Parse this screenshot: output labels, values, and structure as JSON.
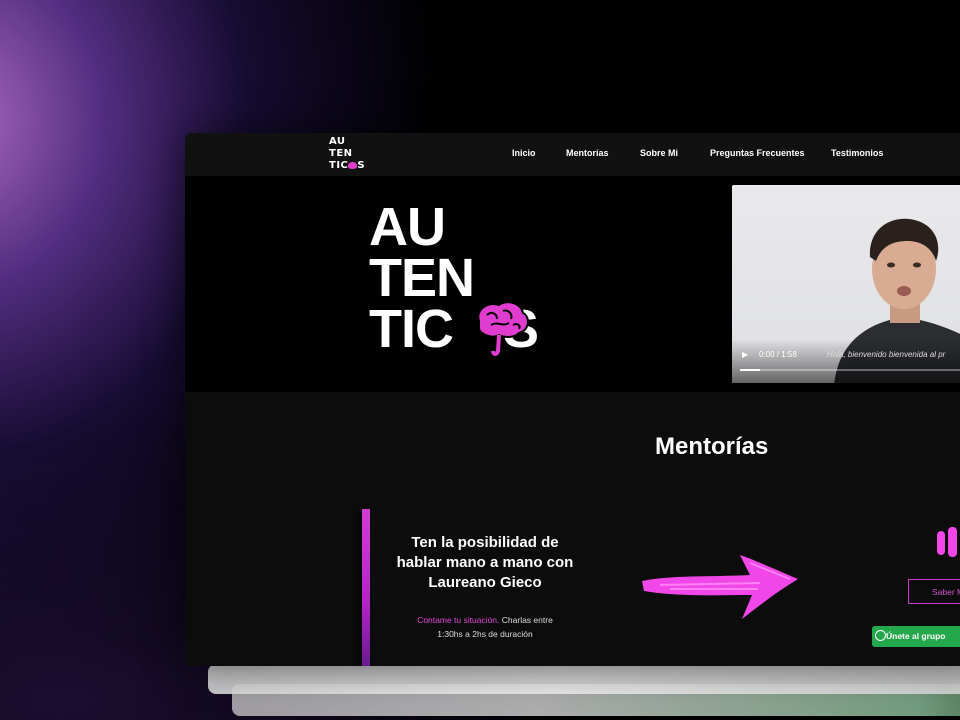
{
  "brand": {
    "logo_line1": "AU",
    "logo_line2": "TEN",
    "logo_line3_start": "TIC",
    "logo_line3_end": "S",
    "logo_alt": "AUTENTICOS"
  },
  "nav": {
    "items": [
      {
        "label": "Inicio"
      },
      {
        "label": "Mentorías"
      },
      {
        "label": "Sobre Mi"
      },
      {
        "label": "Preguntas Frecuentes"
      },
      {
        "label": "Testimonios"
      }
    ]
  },
  "video": {
    "time": "0:00 / 1:58",
    "caption": "Hola, bienvenido bienvenida al pr",
    "progress": 0.08,
    "play_icon": "play-icon"
  },
  "mentorias": {
    "title": "Mentorías",
    "card_heading": "Ten la posibilidad de hablar mano a mano con Laureano Gieco",
    "desc_highlight": "Contame tu situación.",
    "desc_rest": " Charlas entre 1:30hs a 2hs de duración",
    "saber_button": "Saber M",
    "whatsapp_button": "Únete al grupo"
  },
  "colors": {
    "accent": "#e03cd0",
    "whatsapp": "#23a84b",
    "page_bg": "#0c0c0d"
  }
}
